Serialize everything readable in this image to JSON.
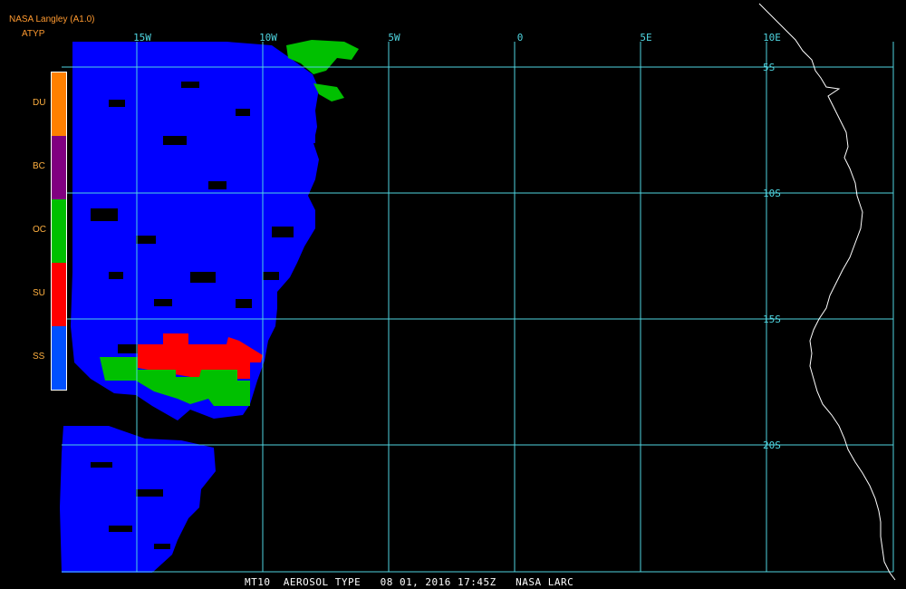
{
  "header": {
    "source": "NASA Langley (A1.0)",
    "product": "ATYP"
  },
  "legend": [
    {
      "code": "DU",
      "color": "#ff8000"
    },
    {
      "code": "BC",
      "color": "#800080"
    },
    {
      "code": "OC",
      "color": "#00c000"
    },
    {
      "code": "SU",
      "color": "#ff0000"
    },
    {
      "code": "SS",
      "color": "#0050ff"
    }
  ],
  "map": {
    "grid_color": "#4fd5e0",
    "longitude_labels": [
      "15W",
      "10W",
      "5W",
      "0",
      "5E",
      "10E"
    ],
    "latitude_labels": [
      "5S",
      "10S",
      "15S",
      "20S"
    ],
    "coastline_color": "#ffffff",
    "aerosol_colors": {
      "sea_salt": "#0000ff",
      "sulfate": "#ff0000",
      "organic_carbon": "#00c000"
    }
  },
  "footer": {
    "caption": "MT10  AEROSOL TYPE   08 01, 2016 17:45Z   NASA LARC"
  }
}
